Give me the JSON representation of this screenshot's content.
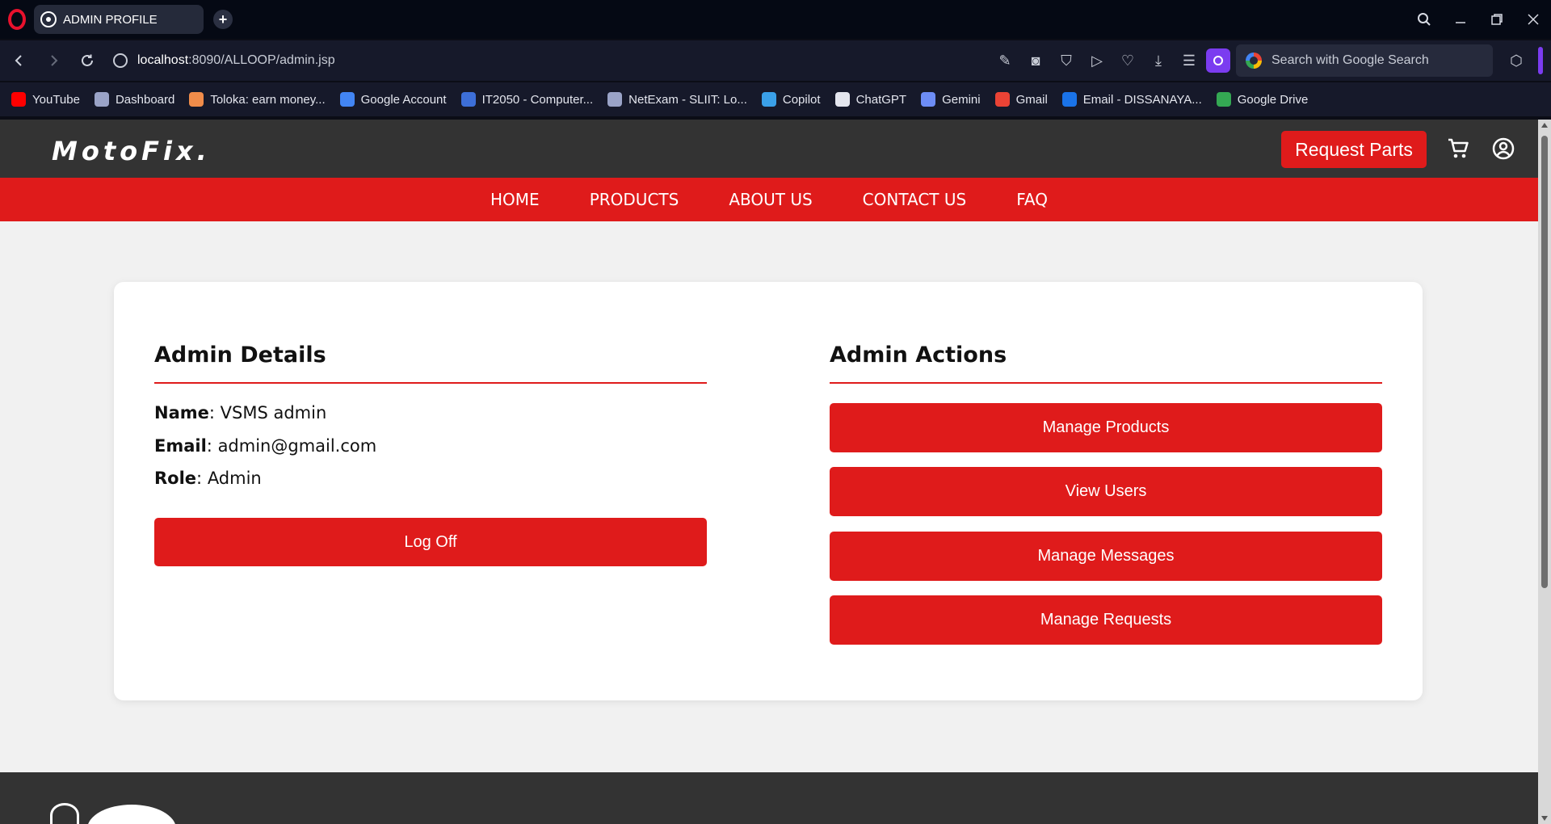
{
  "browser": {
    "tab_title": "ADMIN PROFILE",
    "url_host": "localhost",
    "url_rest": ":8090/ALLOOP/admin.jsp",
    "search_placeholder": "Search with Google Search",
    "bookmarks": [
      {
        "label": "YouTube",
        "color": "#ff0000"
      },
      {
        "label": "Dashboard",
        "color": "#9aa3c7"
      },
      {
        "label": "Toloka: earn money...",
        "color": "#f08c4a"
      },
      {
        "label": "Google Account",
        "color": "#4285f4"
      },
      {
        "label": "IT2050 - Computer...",
        "color": "#3d6fd8"
      },
      {
        "label": "NetExam - SLIIT: Lo...",
        "color": "#9aa3c7"
      },
      {
        "label": "Copilot",
        "color": "#3aa0e8"
      },
      {
        "label": "ChatGPT",
        "color": "#e4e6ee"
      },
      {
        "label": "Gemini",
        "color": "#6d8df6"
      },
      {
        "label": "Gmail",
        "color": "#ea4335"
      },
      {
        "label": "Email - DISSANAYA...",
        "color": "#1a73e8"
      },
      {
        "label": "Google Drive",
        "color": "#34a853"
      }
    ]
  },
  "site": {
    "logo": "MotoFix.",
    "request_parts_label": "Request Parts",
    "nav": [
      "HOME",
      "PRODUCTS",
      "ABOUT US",
      "CONTACT US",
      "FAQ"
    ],
    "accent_color": "#df1b1b",
    "header_color": "#333333"
  },
  "details": {
    "title": "Admin Details",
    "name_label": "Name",
    "name_value": "VSMS admin",
    "email_label": "Email",
    "email_value": "admin@gmail.com",
    "role_label": "Role",
    "role_value": "Admin",
    "logoff_label": "Log Off"
  },
  "actions": {
    "title": "Admin Actions",
    "buttons": [
      "Manage Products",
      "View Users",
      "Manage Messages",
      "Manage Requests"
    ]
  }
}
